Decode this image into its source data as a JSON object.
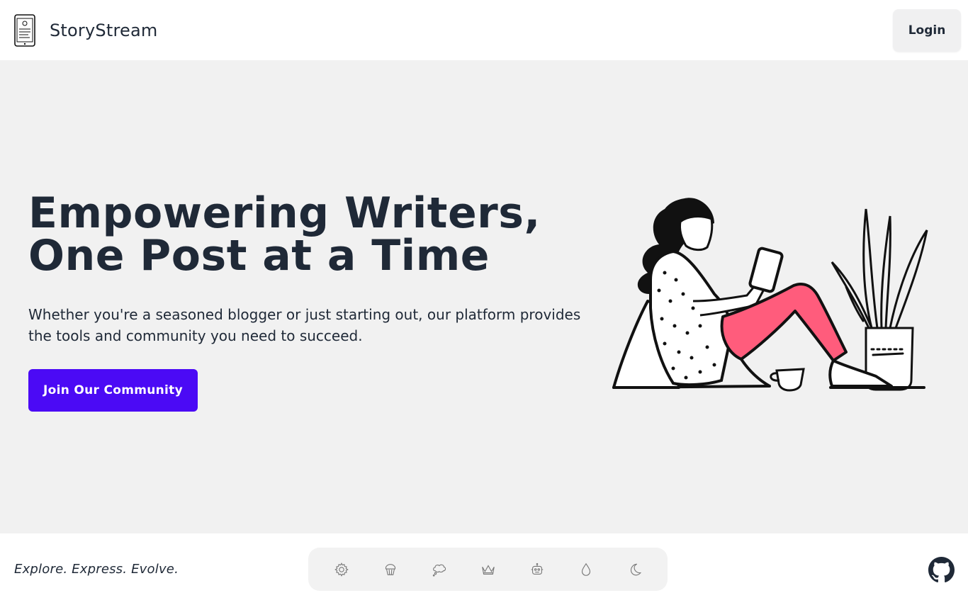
{
  "header": {
    "brand_name": "StoryStream",
    "login_label": "Login"
  },
  "hero": {
    "title_line1": "Empowering Writers,",
    "title_line2": "One Post at a Time",
    "subtitle": "Whether you're a seasoned blogger or just starting out, our platform provides the tools and community you need to succeed.",
    "cta_label": "Join Our Community"
  },
  "footer": {
    "tagline": "Explore. Express. Evolve.",
    "theme_icons": [
      "gear-icon",
      "cupcake-icon",
      "thought-bubble-icon",
      "crown-icon",
      "robot-icon",
      "droplet-icon",
      "moon-icon"
    ],
    "github_icon": "github-icon"
  },
  "colors": {
    "accent": "#4b0af5",
    "hero_bg": "#f1f1f1",
    "text": "#1f2937",
    "pants": "#ff5c7c"
  }
}
